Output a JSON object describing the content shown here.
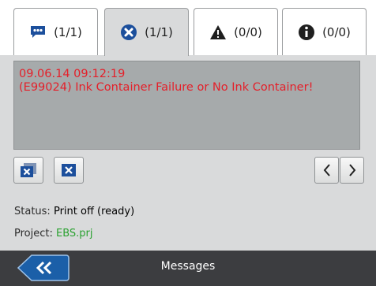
{
  "tabs": [
    {
      "icon": "message-icon",
      "count": "(1/1)",
      "active": false
    },
    {
      "icon": "error-x-circle-icon",
      "count": "(1/1)",
      "active": true
    },
    {
      "icon": "warning-triangle-icon",
      "count": "(0/0)",
      "active": false
    },
    {
      "icon": "info-circle-icon",
      "count": "(0/0)",
      "active": false
    }
  ],
  "message": {
    "timestamp": "09.06.14 09:12:19",
    "text": "(E99024) Ink Container Failure or No Ink Container!"
  },
  "status": {
    "label": "Status:",
    "value": "Print off (ready)"
  },
  "project": {
    "label": "Project:",
    "value": "EBS.prj"
  },
  "bottombar": {
    "title": "Messages"
  },
  "colors": {
    "error_text": "#e4202a",
    "accent_blue": "#1c4f9c",
    "project_green": "#2aa130"
  }
}
